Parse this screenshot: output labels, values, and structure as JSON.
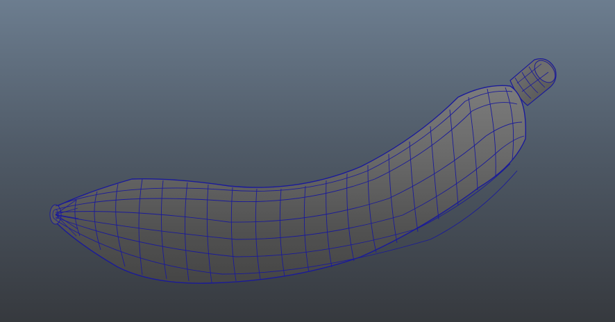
{
  "viewport": {
    "background_top": "#6c7d8f",
    "background_bottom": "#36393e"
  },
  "model": {
    "object": "banana-mesh",
    "display_mode": "smooth-shade-with-wireframe",
    "shade_color": "#595959",
    "highlight_color": "#7a7a7a",
    "wireframe_color": "#1a1a9a"
  }
}
